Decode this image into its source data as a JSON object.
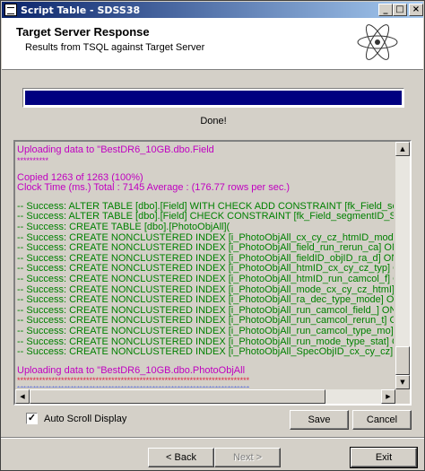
{
  "window": {
    "title": "Script Table - SDSS38",
    "buttons": {
      "minimize": "_",
      "maximize": "□",
      "close": "×"
    }
  },
  "header": {
    "title": "Target Server Response",
    "subtitle": "Results from TSQL against Target Server",
    "logo_icon": "atom-icon"
  },
  "progress": {
    "value": 1.0,
    "color": "#000080"
  },
  "status": {
    "done": "Done!"
  },
  "log": {
    "upload1": "Uploading data to \"BestDR6_10GB.dbo.Field",
    "stars1": "**********",
    "copied": "Copied 1263 of 1263 (100%)",
    "clock": "Clock Time (ms.) Total     :  7145    Average : (176.77 rows per sec.)",
    "lines": [
      "-- Success: ALTER TABLE [dbo].[Field]  WITH CHECK ADD  CONSTRAINT [fk_Field_segmen",
      "-- Success: ALTER TABLE [dbo].[Field] CHECK CONSTRAINT [fk_Field_segmentID_Segment",
      "-- Success: CREATE TABLE [dbo].[PhotoObjAll](",
      "-- Success: CREATE NONCLUSTERED INDEX [i_PhotoObjAll_cx_cy_cz_htmID_mod] ON [dbo].",
      "-- Success: CREATE NONCLUSTERED INDEX [i_PhotoObjAll_field_run_rerun_ca] ON [dbo].",
      "-- Success: CREATE NONCLUSTERED INDEX [i_PhotoObjAll_fieldID_objID_ra_d] ON [dbo].",
      "-- Success: CREATE NONCLUSTERED INDEX [i_PhotoObjAll_htmID_cx_cy_cz_typ] ON [dbo].",
      "-- Success: CREATE NONCLUSTERED INDEX [i_PhotoObjAll_htmID_run_camcol_f] ON [dbo].",
      "-- Success: CREATE NONCLUSTERED INDEX [i_PhotoObjAll_mode_cx_cy_cz_htmI] ON [dbo].",
      "-- Success: CREATE NONCLUSTERED INDEX [i_PhotoObjAll_ra_dec_type_mode] ON [dbo].[P",
      "-- Success: CREATE NONCLUSTERED INDEX [i_PhotoObjAll_run_camcol_field_] ON [dbo].",
      "-- Success: CREATE NONCLUSTERED INDEX [i_PhotoObjAll_run_camcol_rerun_t] ON [dbo].",
      "-- Success: CREATE NONCLUSTERED INDEX [i_PhotoObjAll_run_camcol_type_mo] ON [dbo].",
      "-- Success: CREATE NONCLUSTERED INDEX [i_PhotoObjAll_run_mode_type_stat] ON [dbo].",
      "-- Success: CREATE NONCLUSTERED INDEX [i_PhotoObjAll_SpecObjID_cx_cy_cz] ON [dbo]."
    ],
    "upload2": "Uploading data to \"BestDR6_10GB.dbo.PhotoObjAll",
    "stars_red": "**************************************************************************",
    "stars_blue": "**************************************************************************",
    "stars_mixed": "**************************************************************************",
    "colors": {
      "pink": "#c000c0",
      "green": "#008000",
      "red": "#e02040",
      "blue": "#2040e0"
    }
  },
  "controls": {
    "auto_scroll_label": "Auto Scroll Display",
    "auto_scroll_checked": true,
    "save_label": "Save",
    "cancel_label": "Cancel"
  },
  "nav": {
    "back_label": "< Back",
    "next_label": "Next >",
    "exit_label": "Exit"
  }
}
